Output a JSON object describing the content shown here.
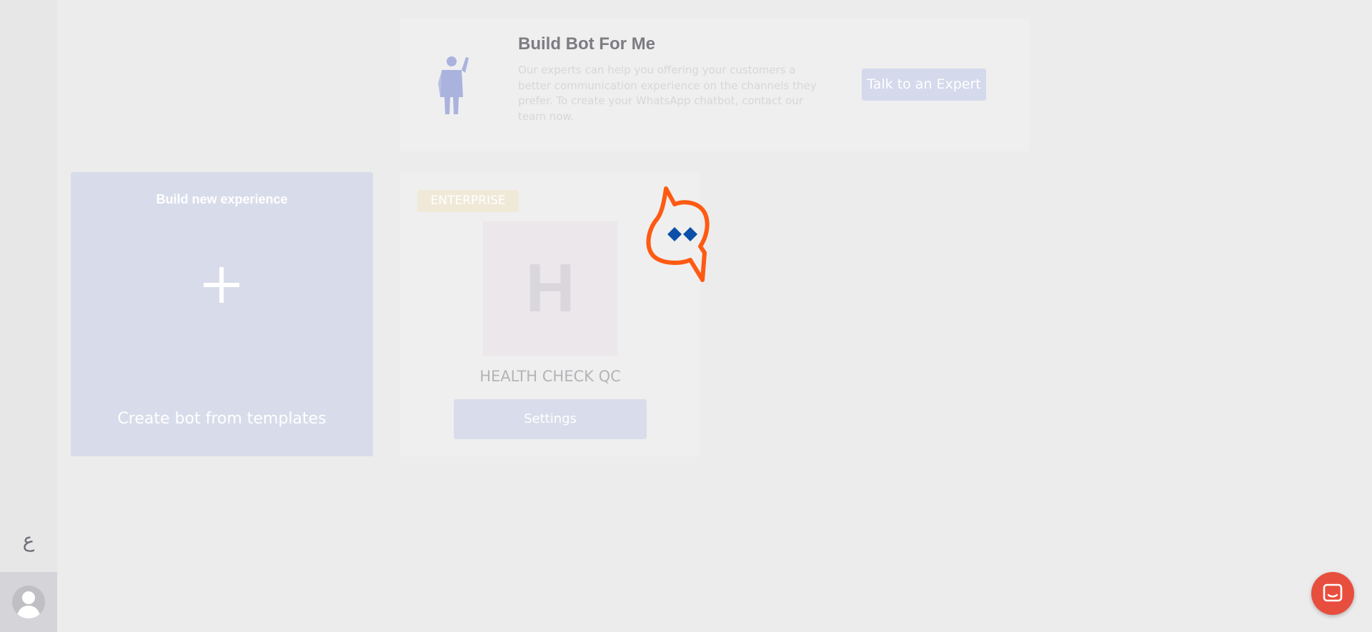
{
  "sidebar": {
    "language_toggle": "ع"
  },
  "banner": {
    "title": "Build Bot For Me",
    "description": "Our experts can help you offering your customers a better communication experience on the channels they prefer. To create your WhatsApp chatbot, contact our team now.",
    "button_label": "Talk to an Expert"
  },
  "create_card": {
    "title": "Build new experience",
    "subtitle": "Create bot from templates"
  },
  "bot_card": {
    "badge": "ENTERPRISE",
    "initial": "H",
    "name": "HEALTH CHECK QC",
    "settings_label": "Settings"
  },
  "icons": {
    "expert": "expert-person-icon",
    "plus": "plus-icon",
    "loader": "brand-logo-spinner-icon",
    "chat": "chat-icon",
    "avatar": "user-avatar-icon"
  },
  "colors": {
    "accent": "#d5d9ec",
    "chat_launcher": "#e84e3e",
    "logo_orange": "#ff5a12",
    "logo_blue": "#0c4fa8"
  }
}
